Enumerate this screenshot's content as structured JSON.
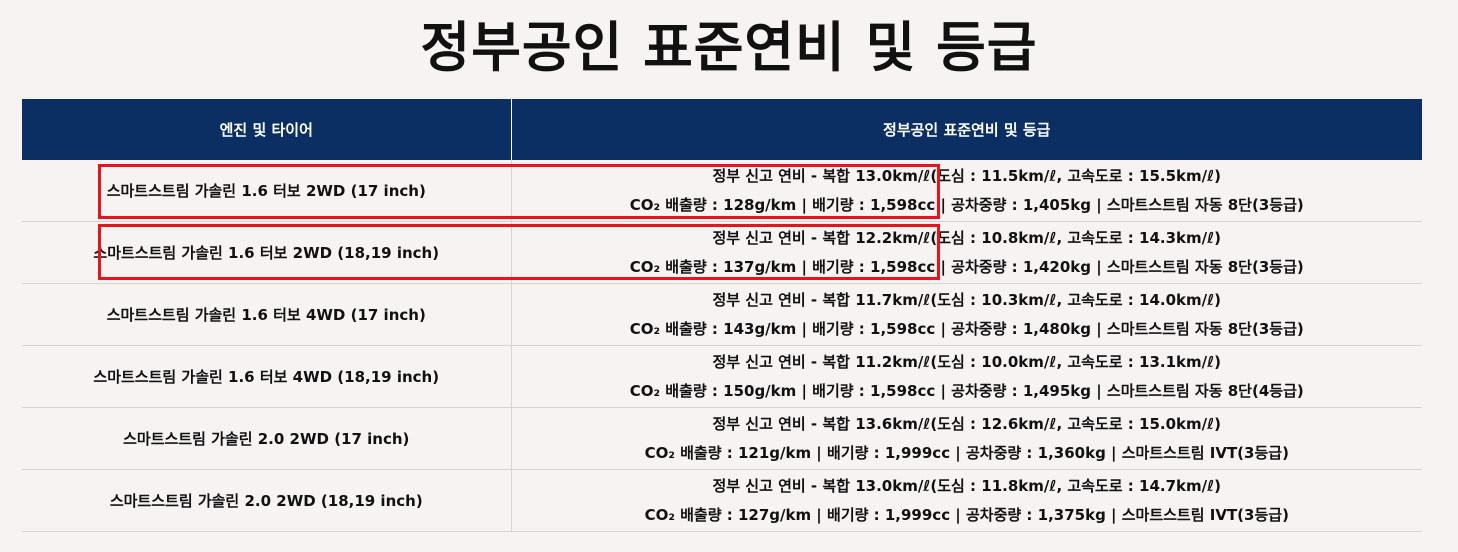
{
  "page_title": "정부공인 표준연비 및 등급",
  "table": {
    "headers": [
      "엔진 및 타이어",
      "정부공인 표준연비 및 등급"
    ],
    "rows": [
      {
        "engine": "스마트스트림 가솔린 1.6 터보 2WD (17 inch)",
        "line1": "정부 신고 연비 - 복합 13.0km/ℓ(도심 : 11.5km/ℓ, 고속도로 : 15.5km/ℓ)",
        "line2": "CO₂ 배출량 : 128g/km | 배기량 : 1,598cc | 공차중량 : 1,405kg | 스마트스트림 자동 8단(3등급)"
      },
      {
        "engine": "스마트스트림 가솔린 1.6 터보 2WD (18,19 inch)",
        "line1": "정부 신고 연비 - 복합 12.2km/ℓ(도심 : 10.8km/ℓ, 고속도로 : 14.3km/ℓ)",
        "line2": "CO₂ 배출량 : 137g/km | 배기량 : 1,598cc | 공차중량 : 1,420kg | 스마트스트림 자동 8단(3등급)"
      },
      {
        "engine": "스마트스트림 가솔린 1.6 터보 4WD (17 inch)",
        "line1": "정부 신고 연비 - 복합 11.7km/ℓ(도심 : 10.3km/ℓ, 고속도로 : 14.0km/ℓ)",
        "line2": "CO₂ 배출량 : 143g/km | 배기량 : 1,598cc | 공차중량 : 1,480kg | 스마트스트림 자동 8단(3등급)"
      },
      {
        "engine": "스마트스트림 가솔린 1.6 터보 4WD (18,19 inch)",
        "line1": "정부 신고 연비 - 복합 11.2km/ℓ(도심 : 10.0km/ℓ, 고속도로 : 13.1km/ℓ)",
        "line2": "CO₂ 배출량 : 150g/km | 배기량 : 1,598cc | 공차중량 : 1,495kg | 스마트스트림 자동 8단(4등급)"
      },
      {
        "engine": "스마트스트림 가솔린 2.0 2WD (17 inch)",
        "line1": "정부 신고 연비 - 복합 13.6km/ℓ(도심 : 12.6km/ℓ, 고속도로 : 15.0km/ℓ)",
        "line2": "CO₂ 배출량 : 121g/km | 배기량 : 1,999cc | 공차중량 : 1,360kg | 스마트스트림 IVT(3등급)"
      },
      {
        "engine": "스마트스트림 가솔린 2.0 2WD (18,19 inch)",
        "line1": "정부 신고 연비 - 복합 13.0km/ℓ(도심 : 11.8km/ℓ, 고속도로 : 14.7km/ℓ)",
        "line2": "CO₂ 배출량 : 127g/km | 배기량 : 1,999cc | 공차중량 : 1,375kg | 스마트스트림 IVT(3등급)"
      }
    ]
  },
  "colors": {
    "header_bg": "#0b2e63",
    "highlight": "#e8141b",
    "page_bg": "#f7f3f2"
  }
}
